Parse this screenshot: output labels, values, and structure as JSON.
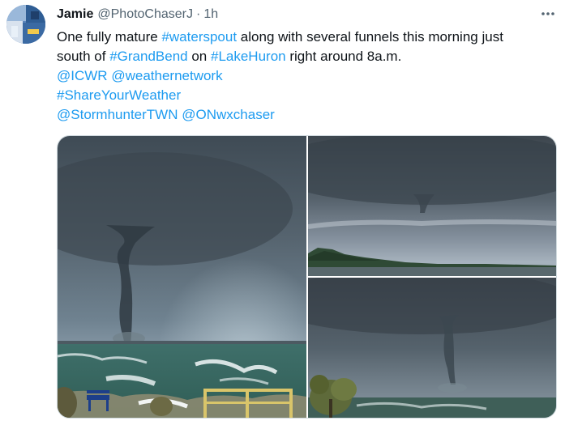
{
  "author": {
    "display_name": "Jamie",
    "handle": "@PhotoChaserJ",
    "separator": "·",
    "timestamp": "1h",
    "avatar_icon": "profile-photo-collage"
  },
  "menu": {
    "icon": "more-horizontal-icon"
  },
  "tweet": {
    "line1": {
      "t1": "One fully mature ",
      "h1": "#waterspout",
      "t2": " along with several funnels this morning just"
    },
    "line2": {
      "t1": "south of ",
      "h1": "#GrandBend",
      "t2": " on ",
      "h2": "#LakeHuron",
      "t3": " right around 8a.m."
    },
    "line3": {
      "m1": "@ICWR",
      "t1": " ",
      "m2": "@weathernetwork"
    },
    "line4": {
      "h1": "#ShareYourWeather"
    },
    "line5": {
      "m1": "@StormhunterTWN",
      "t1": " ",
      "m2": "@ONwxchaser"
    }
  },
  "media": {
    "photos": [
      {
        "subject": "waterspout over lake with beach railing and bench"
      },
      {
        "subject": "funnel cloud over treeline shoreline"
      },
      {
        "subject": "waterspout over lake with tree in foreground"
      }
    ]
  },
  "colors": {
    "link": "#1d9bf0",
    "text": "#0f1419",
    "muted": "#536471",
    "border": "#cfd9de"
  }
}
